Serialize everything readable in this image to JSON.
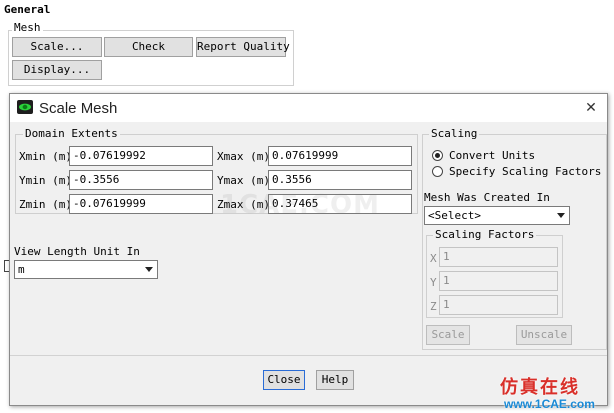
{
  "general_panel": {
    "title": "General",
    "mesh_group_label": "Mesh",
    "scale_button": "Scale...",
    "check_button": "Check",
    "report_quality_button": "Report Quality",
    "display_button": "Display..."
  },
  "dialog": {
    "title": "Scale Mesh",
    "close_glyph": "✕",
    "domain_extents": {
      "label": "Domain Extents",
      "xmin_label": "Xmin (m)",
      "xmin_value": "-0.07619992",
      "xmax_label": "Xmax (m)",
      "xmax_value": "0.07619999",
      "ymin_label": "Ymin (m)",
      "ymin_value": "-0.3556",
      "ymax_label": "Ymax (m)",
      "ymax_value": "0.3556",
      "zmin_label": "Zmin (m)",
      "zmin_value": "-0.07619999",
      "zmax_label": "Zmax (m)",
      "zmax_value": "0.37465"
    },
    "view_length_unit": {
      "label": "View Length Unit In",
      "value": "m"
    },
    "scaling": {
      "label": "Scaling",
      "convert_units": "Convert Units",
      "specify_scaling_factors": "Specify Scaling Factors",
      "selected": "Convert Units"
    },
    "mesh_created_in": {
      "label": "Mesh Was Created In",
      "value": "<Select>"
    },
    "scaling_factors": {
      "label": "Scaling Factors",
      "x_label": "X",
      "x_value": "1",
      "y_label": "Y",
      "y_value": "1",
      "z_label": "Z",
      "z_value": "1"
    },
    "scale_button": "Scale",
    "unscale_button": "Unscale",
    "close_button": "Close",
    "help_button": "Help"
  },
  "watermark": {
    "text": "1CAE.COM",
    "cn_text": "仿真在线",
    "url": "www.1CAE.com"
  },
  "colors": {
    "dialog_bg": "#f0f0f0",
    "watermark_red": "#d9302a",
    "watermark_blue": "#1a8ad6"
  }
}
